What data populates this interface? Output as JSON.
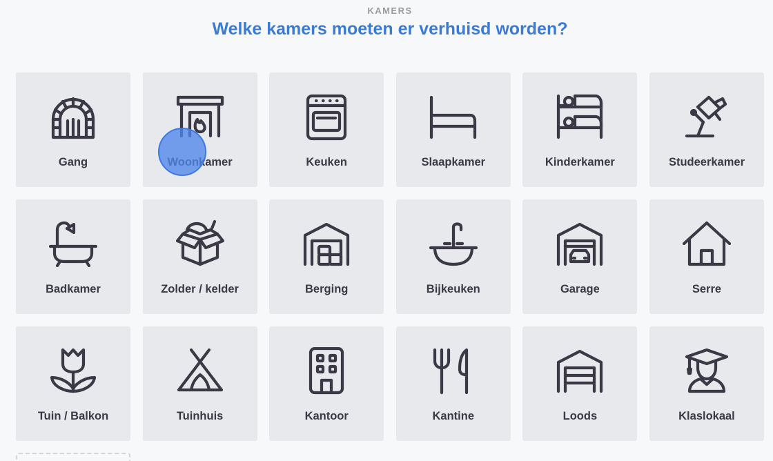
{
  "header": {
    "eyebrow": "KAMERS",
    "title": "Welke kamers moeten er verhuisd worden?"
  },
  "rooms": [
    {
      "label": "Gang",
      "icon": "archway-icon"
    },
    {
      "label": "Woonkamer",
      "icon": "fireplace-icon"
    },
    {
      "label": "Keuken",
      "icon": "oven-icon"
    },
    {
      "label": "Slaapkamer",
      "icon": "bed-icon"
    },
    {
      "label": "Kinderkamer",
      "icon": "bunk-bed-icon"
    },
    {
      "label": "Studeerkamer",
      "icon": "desk-lamp-icon"
    },
    {
      "label": "Badkamer",
      "icon": "bathtub-icon"
    },
    {
      "label": "Zolder / kelder",
      "icon": "open-box-icon"
    },
    {
      "label": "Berging",
      "icon": "storage-shed-icon"
    },
    {
      "label": "Bijkeuken",
      "icon": "sink-icon"
    },
    {
      "label": "Garage",
      "icon": "garage-car-icon"
    },
    {
      "label": "Serre",
      "icon": "house-icon"
    },
    {
      "label": "Tuin / Balkon",
      "icon": "tulip-icon"
    },
    {
      "label": "Tuinhuis",
      "icon": "tent-icon"
    },
    {
      "label": "Kantoor",
      "icon": "office-building-icon"
    },
    {
      "label": "Kantine",
      "icon": "fork-knife-icon"
    },
    {
      "label": "Loods",
      "icon": "warehouse-icon"
    },
    {
      "label": "Klaslokaal",
      "icon": "graduate-icon"
    }
  ],
  "colors": {
    "accent": "#3a7bd5",
    "tile_bg": "#e8e9ed",
    "icon_stroke": "#3a3945",
    "cursor_highlight": "#5087eb"
  }
}
